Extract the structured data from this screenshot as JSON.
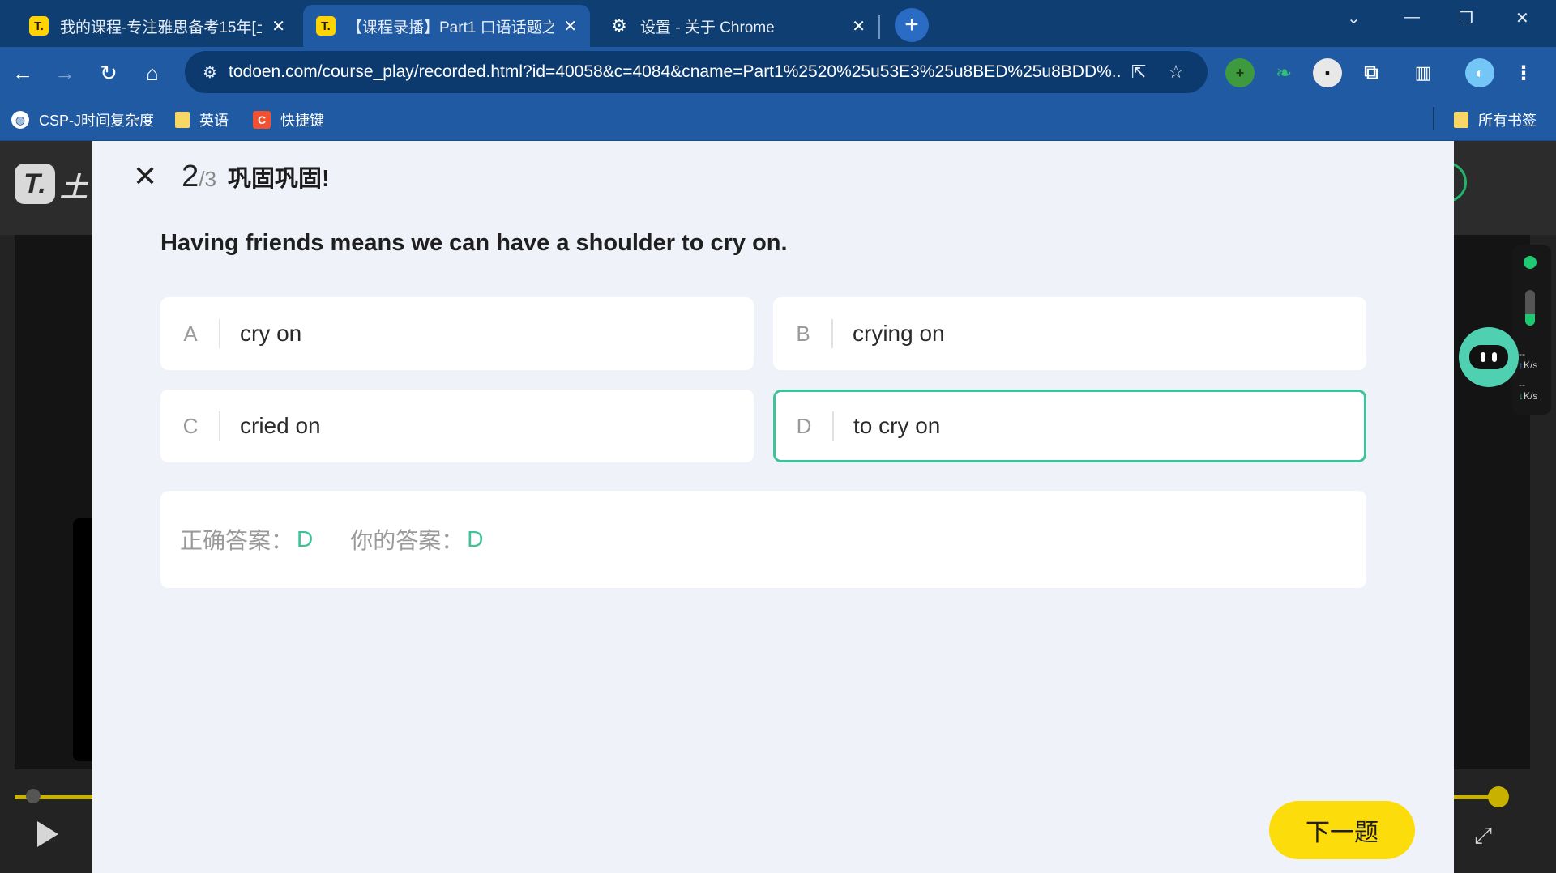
{
  "browser": {
    "tabs": [
      {
        "favicon": "T.",
        "title": "我的课程-专注雅思备考15年[土",
        "active": false
      },
      {
        "favicon": "T.",
        "title": "【课程录播】Part1 口语话题之",
        "active": true
      },
      {
        "favicon": "⚙",
        "title": "设置 - 关于 Chrome",
        "active": false
      }
    ],
    "new_tab_label": "+",
    "url": "todoen.com/course_play/recorded.html?id=40058&c=4084&cname=Part1%2520%25u53E3%25u8BED%25u8BDD%...",
    "bookmarks": [
      {
        "label": "CSP-J时间复杂度",
        "icon": "globe-icon"
      },
      {
        "label": "英语",
        "icon": "folder-icon"
      },
      {
        "label": "快捷键",
        "icon": "c-logo-icon"
      }
    ],
    "all_bookmarks_label": "所有书签"
  },
  "player": {
    "logo_text": "土",
    "speed_up": "K/s",
    "speed_down": "K/s",
    "speed_up_value": "--",
    "speed_down_value": "--"
  },
  "quiz": {
    "current": "2",
    "total": "/3",
    "title": "巩固巩固!",
    "sentence": "Having friends means we can have a shoulder to cry on.",
    "options": [
      {
        "letter": "A",
        "text": "cry on"
      },
      {
        "letter": "B",
        "text": "crying on"
      },
      {
        "letter": "C",
        "text": "cried on"
      },
      {
        "letter": "D",
        "text": "to cry on"
      }
    ],
    "selected_option": "D",
    "correct_label": "正确答案：",
    "correct_value": "D",
    "your_label": "你的答案：",
    "your_value": "D",
    "next_button": "下一题"
  },
  "colors": {
    "accent_green": "#3dc29a",
    "button_yellow": "#fcdc0a",
    "chrome_blue": "#1f5aa3"
  }
}
